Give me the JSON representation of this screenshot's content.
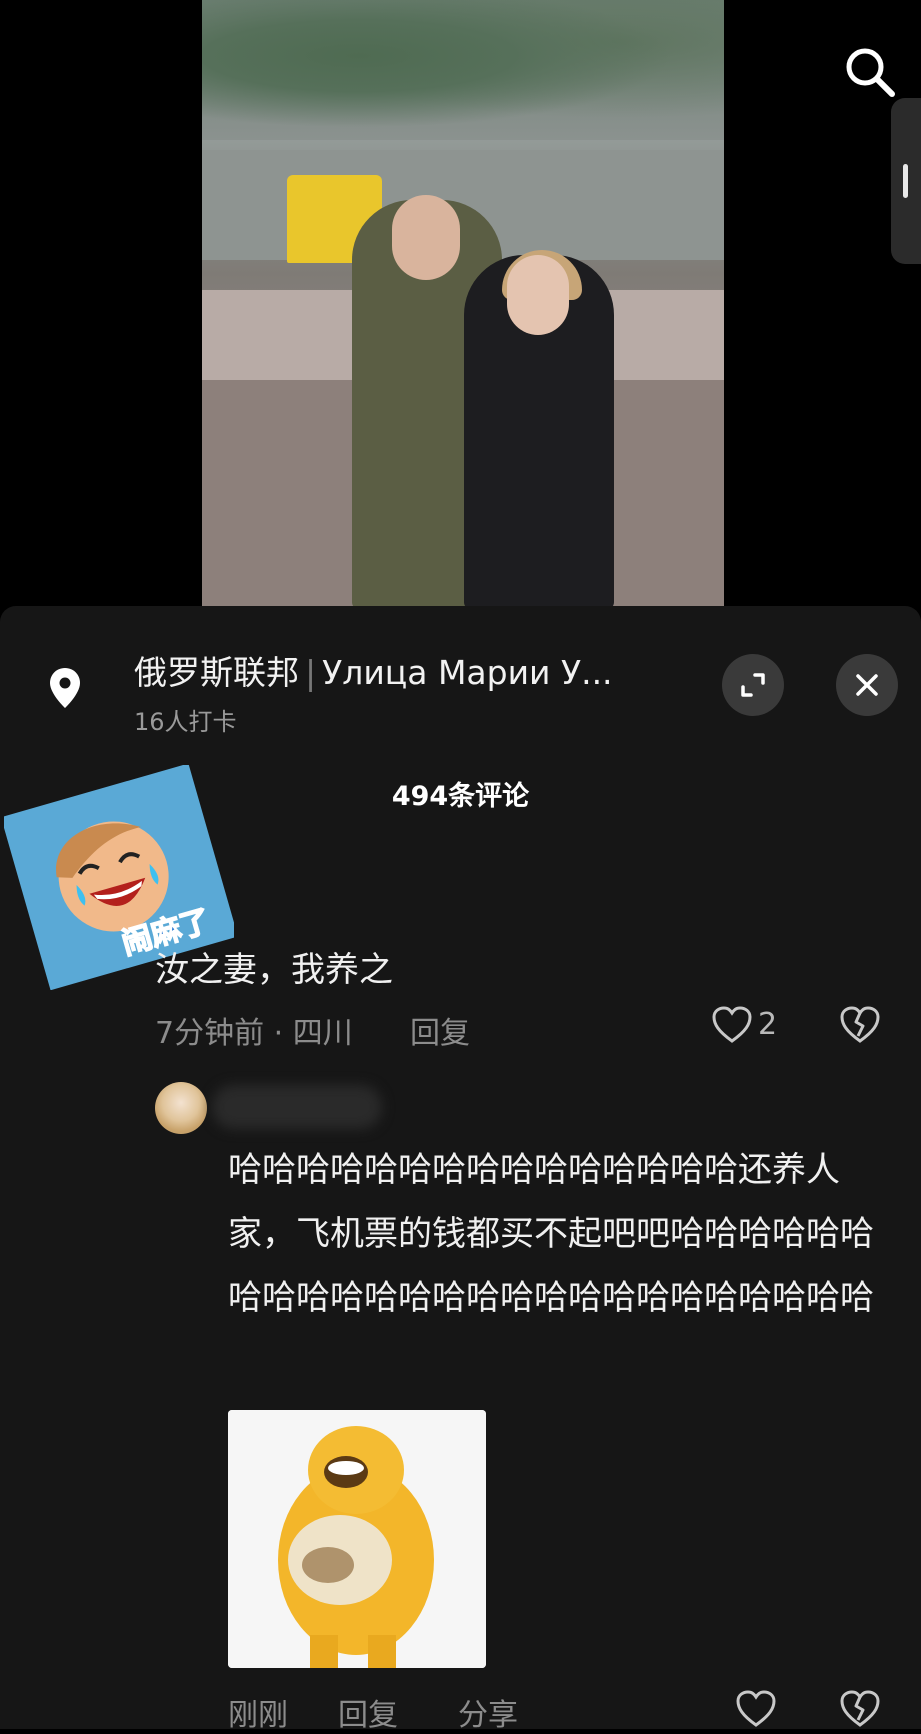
{
  "location": {
    "name_cn": "俄罗斯联邦",
    "name_ru": "Улица Марии У...",
    "checkins": "16人打卡"
  },
  "comments": {
    "count_label": "494条评论",
    "first": {
      "sticker_text": "闹麻了",
      "text": "汝之妻，我养之",
      "meta": "7分钟前 · 四川",
      "reply_label": "回复",
      "like_count": "2"
    },
    "second": {
      "text": "哈哈哈哈哈哈哈哈哈哈哈哈哈哈哈还养人家，飞机票的钱都买不起吧吧哈哈哈哈哈哈哈哈哈哈哈哈哈哈哈哈哈哈哈哈哈哈哈哈哈",
      "time": "刚刚",
      "reply_label": "回复",
      "share_label": "分享"
    }
  },
  "icons": {
    "search": "search-icon",
    "location": "location-pin-icon",
    "expand": "expand-icon",
    "close": "close-icon",
    "like": "heart-icon",
    "dislike": "broken-heart-icon"
  },
  "colors": {
    "sheet_bg": "#161616",
    "meta_text": "#8c8c8c",
    "sticker_blue": "#5aa9d6"
  }
}
